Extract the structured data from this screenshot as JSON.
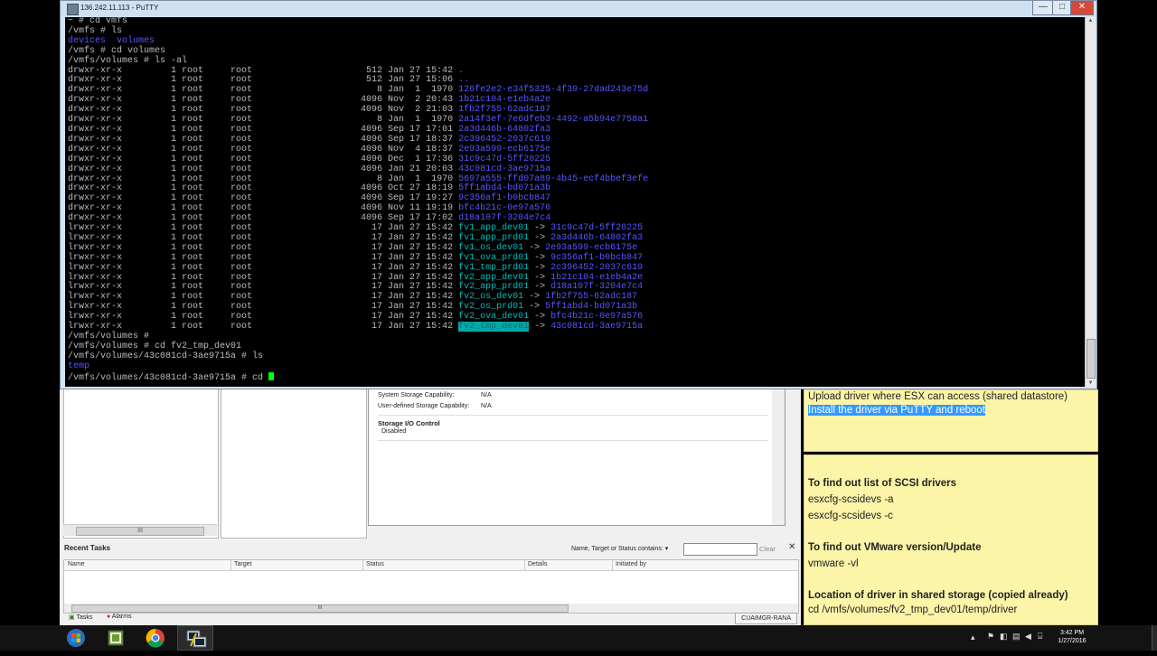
{
  "putty": {
    "title": "136.242.11.113 - PuTTY",
    "controls": {
      "minimize": "—",
      "maximize": "□",
      "close": "✕"
    },
    "terminal": {
      "prompt_lines": [
        "~ # cd vmfs",
        "/vmfs # ls"
      ],
      "ls_vmfs": {
        "a": "devices",
        "b": "volumes"
      },
      "after_ls_lines": [
        "/vmfs # cd volumes",
        "/vmfs/volumes # ls -al"
      ],
      "listing": [
        {
          "perms": "drwxr-xr-x",
          "links": "1",
          "owner": "root",
          "group": "root",
          "size": "512",
          "date": "Jan 27 15:42",
          "name": ".",
          "target": ""
        },
        {
          "perms": "drwxr-xr-x",
          "links": "1",
          "owner": "root",
          "group": "root",
          "size": "512",
          "date": "Jan 27 15:06",
          "name": "..",
          "target": ""
        },
        {
          "perms": "drwxr-xr-x",
          "links": "1",
          "owner": "root",
          "group": "root",
          "size": "8",
          "date": "Jan  1  1970",
          "name": "126fe2e2-e34f5325-4f39-27dad243e75d",
          "target": ""
        },
        {
          "perms": "drwxr-xr-x",
          "links": "1",
          "owner": "root",
          "group": "root",
          "size": "4096",
          "date": "Nov  2 20:43",
          "name": "1b21c104-e1eb4a2e",
          "target": ""
        },
        {
          "perms": "drwxr-xr-x",
          "links": "1",
          "owner": "root",
          "group": "root",
          "size": "4096",
          "date": "Nov  2 21:03",
          "name": "1fb2f755-62adc187",
          "target": ""
        },
        {
          "perms": "drwxr-xr-x",
          "links": "1",
          "owner": "root",
          "group": "root",
          "size": "8",
          "date": "Jan  1  1970",
          "name": "2a14f3ef-7e6dfeb3-4492-a5b94e7758a1",
          "target": ""
        },
        {
          "perms": "drwxr-xr-x",
          "links": "1",
          "owner": "root",
          "group": "root",
          "size": "4096",
          "date": "Sep 17 17:01",
          "name": "2a3d446b-64802fa3",
          "target": ""
        },
        {
          "perms": "drwxr-xr-x",
          "links": "1",
          "owner": "root",
          "group": "root",
          "size": "4096",
          "date": "Sep 17 18:37",
          "name": "2c396452-2037c619",
          "target": ""
        },
        {
          "perms": "drwxr-xr-x",
          "links": "1",
          "owner": "root",
          "group": "root",
          "size": "4096",
          "date": "Nov  4 18:37",
          "name": "2e93a599-ecb6175e",
          "target": ""
        },
        {
          "perms": "drwxr-xr-x",
          "links": "1",
          "owner": "root",
          "group": "root",
          "size": "4096",
          "date": "Dec  1 17:36",
          "name": "31c9c47d-5ff20225",
          "target": ""
        },
        {
          "perms": "drwxr-xr-x",
          "links": "1",
          "owner": "root",
          "group": "root",
          "size": "4096",
          "date": "Jan 21 20:03",
          "name": "43c081cd-3ae9715a",
          "target": ""
        },
        {
          "perms": "drwxr-xr-x",
          "links": "1",
          "owner": "root",
          "group": "root",
          "size": "8",
          "date": "Jan  1  1970",
          "name": "5697a555-ffd07a89-4b45-ecf4bbef3efe",
          "target": ""
        },
        {
          "perms": "drwxr-xr-x",
          "links": "1",
          "owner": "root",
          "group": "root",
          "size": "4096",
          "date": "Oct 27 18:19",
          "name": "5ff1abd4-bd071a3b",
          "target": ""
        },
        {
          "perms": "drwxr-xr-x",
          "links": "1",
          "owner": "root",
          "group": "root",
          "size": "4096",
          "date": "Sep 17 19:27",
          "name": "9c356af1-b0bcb847",
          "target": ""
        },
        {
          "perms": "drwxr-xr-x",
          "links": "1",
          "owner": "root",
          "group": "root",
          "size": "4096",
          "date": "Nov 11 19:19",
          "name": "bfc4b21c-0e97a576",
          "target": ""
        },
        {
          "perms": "drwxr-xr-x",
          "links": "1",
          "owner": "root",
          "group": "root",
          "size": "4096",
          "date": "Sep 17 17:02",
          "name": "d18a107f-3204e7c4",
          "target": ""
        },
        {
          "perms": "lrwxr-xr-x",
          "links": "1",
          "owner": "root",
          "group": "root",
          "size": "17",
          "date": "Jan 27 15:42",
          "name": "fv1_app_dev01",
          "target": "31c9c47d-5ff20225"
        },
        {
          "perms": "lrwxr-xr-x",
          "links": "1",
          "owner": "root",
          "group": "root",
          "size": "17",
          "date": "Jan 27 15:42",
          "name": "fv1_app_prd01",
          "target": "2a3d446b-64802fa3"
        },
        {
          "perms": "lrwxr-xr-x",
          "links": "1",
          "owner": "root",
          "group": "root",
          "size": "17",
          "date": "Jan 27 15:42",
          "name": "fv1_os_dev01",
          "target": "2e93a599-ecb6175e"
        },
        {
          "perms": "lrwxr-xr-x",
          "links": "1",
          "owner": "root",
          "group": "root",
          "size": "17",
          "date": "Jan 27 15:42",
          "name": "fv1_ova_prd01",
          "target": "9c356af1-b0bcb847"
        },
        {
          "perms": "lrwxr-xr-x",
          "links": "1",
          "owner": "root",
          "group": "root",
          "size": "17",
          "date": "Jan 27 15:42",
          "name": "fv1_tmp_prd01",
          "target": "2c396452-2037c619"
        },
        {
          "perms": "lrwxr-xr-x",
          "links": "1",
          "owner": "root",
          "group": "root",
          "size": "17",
          "date": "Jan 27 15:42",
          "name": "fv2_app_dev01",
          "target": "1b21c104-e1eb4a2e"
        },
        {
          "perms": "lrwxr-xr-x",
          "links": "1",
          "owner": "root",
          "group": "root",
          "size": "17",
          "date": "Jan 27 15:42",
          "name": "fv2_app_prd01",
          "target": "d18a107f-3204e7c4"
        },
        {
          "perms": "lrwxr-xr-x",
          "links": "1",
          "owner": "root",
          "group": "root",
          "size": "17",
          "date": "Jan 27 15:42",
          "name": "fv2_os_dev01",
          "target": "1fb2f755-62adc187"
        },
        {
          "perms": "lrwxr-xr-x",
          "links": "1",
          "owner": "root",
          "group": "root",
          "size": "17",
          "date": "Jan 27 15:42",
          "name": "fv2_os_prd01",
          "target": "5ff1abd4-bd071a3b"
        },
        {
          "perms": "lrwxr-xr-x",
          "links": "1",
          "owner": "root",
          "group": "root",
          "size": "17",
          "date": "Jan 27 15:42",
          "name": "fv2_ova_dev01",
          "target": "bfc4b21c-0e97a576"
        },
        {
          "perms": "lrwxr-xr-x",
          "links": "1",
          "owner": "root",
          "group": "root",
          "size": "17",
          "date": "Jan 27 15:42",
          "name": "fv2_tmp_dev01",
          "target": "43c081cd-3ae9715a",
          "highlight": true
        }
      ],
      "tail_lines": [
        "/vmfs/volumes #",
        "/vmfs/volumes # cd fv2_tmp_dev01",
        "/vmfs/volumes/43c081cd-3ae9715a # ls"
      ],
      "ls_result": "temp",
      "current_prompt": "/vmfs/volumes/43c081cd-3ae9715a # cd ",
      "colors": {
        "dir": "#5555ff",
        "link": "#00bbbb",
        "text": "#bbbbbb",
        "cursor": "#00ff00"
      }
    }
  },
  "vsphere": {
    "detail": {
      "system_storage_label": "System Storage Capability:",
      "system_storage_value": "N/A",
      "user_storage_label": "User-defined Storage Capability:",
      "user_storage_value": "N/A",
      "sioc_title": "Storage I/O Control",
      "sioc_value": "Disabled"
    },
    "hscroll_grip": "III",
    "recent_tasks": {
      "title": "Recent Tasks",
      "filter_label": "Name, Target or Status contains: ▾",
      "filter_value": "",
      "clear_label": "Clear",
      "close": "✕",
      "columns": [
        "Name",
        "Target",
        "Status",
        "Details",
        "Initiated by"
      ],
      "scroll_grip": "III"
    },
    "status_bar": {
      "tasks_tab": "Tasks",
      "alarms_tab": "Alarms",
      "user": "CUAIMGR-RANA"
    }
  },
  "notes": {
    "note1": {
      "line1": "Upload driver where ESX can access (shared datastore)",
      "line2": "Install the driver via PuTTY and reboot"
    },
    "note2": {
      "h1": "To find out list of SCSI drivers",
      "l1": "esxcfg-scsidevs -a",
      "l2": "esxcfg-scsidevs -c",
      "h2": "To find out VMware version/Update",
      "l3": "vmware -vl",
      "h3": "Location of driver in shared storage (copied already)",
      "l4": "cd /vmfs/volumes/fv2_tmp_dev01/temp/driver"
    }
  },
  "taskbar": {
    "apps": [
      "start-orb",
      "vsphere-client",
      "chrome",
      "putty"
    ],
    "clock_time": "3:42 PM",
    "clock_date": "1/27/2016"
  }
}
